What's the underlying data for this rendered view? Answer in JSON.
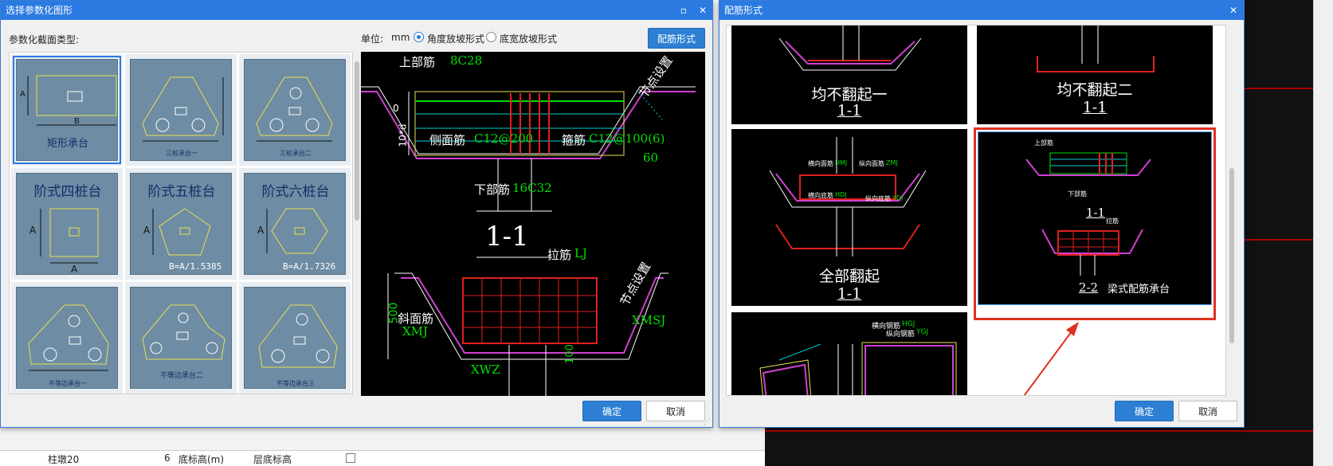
{
  "background": {
    "row_number": "6",
    "row_label": "底标高(m)",
    "row_value": "层底标高",
    "row_partial": "柱墩20"
  },
  "dialog_select": {
    "title": "选择参数化图形",
    "section_type_label": "参数化截面类型:",
    "unit_label": "单位:",
    "unit_value": "mm",
    "radio_angle": "角度放坡形式",
    "radio_width": "底宽放坡形式",
    "rebar_button": "配筋形式",
    "ok_button": "确定",
    "cancel_button": "取消",
    "thumbnails": [
      {
        "label": "矩形承台",
        "dim_a": "A",
        "dim_b": "B"
      },
      {
        "label": "三桩承台一"
      },
      {
        "label": "三桩承台二"
      },
      {
        "label": "阶式四桩台",
        "dim_a": "A",
        "dim_b": "A"
      },
      {
        "label": "阶式五桩台",
        "dim_a": "A",
        "formula": "B=A/1.5385"
      },
      {
        "label": "阶式六桩台",
        "dim_a": "A",
        "formula": "B=A/1.7326"
      },
      {
        "label": "不等边承台一"
      },
      {
        "label": "不等边承台二"
      },
      {
        "label": "不等边承台三"
      }
    ],
    "preview": {
      "top_rebar": "上部筋",
      "top_rebar_val": "8C28",
      "node_setting": "节点设置",
      "side_rebar": "侧面筋",
      "side_rebar_val": "C12@200",
      "stirrup": "箍筋",
      "stirrup_val": "C12@100(6)",
      "angle": "60",
      "dim_zero": "0",
      "dim_10d": "10*d",
      "bottom_rebar": "下部筋",
      "bottom_rebar_val": "16C32",
      "section_11": "1-1",
      "tie_rebar": "拉筋",
      "tie_rebar_val": "LJ",
      "node_setting2": "节点设置",
      "slope_rebar": "斜面筋",
      "slope_code": "XMJ",
      "xmsj": "XMSJ",
      "dim_500": "500",
      "xwz": "XWZ",
      "dim_100": "100"
    }
  },
  "dialog_rebar": {
    "title": "配筋形式",
    "ok_button": "确定",
    "cancel_button": "取消",
    "options": [
      {
        "label": "均不翻起一",
        "section": "1-1"
      },
      {
        "label": "均不翻起二",
        "section": "1-1"
      },
      {
        "label": "全部翻起",
        "section": "1-1"
      },
      {
        "label": "梁式配筋承台",
        "section": "1-1",
        "section2": "2-2"
      }
    ],
    "small_labels": {
      "transverse_top": "横向面筋",
      "tmj": "HMJ",
      "longitudinal_top": "纵向面筋",
      "zmj": "ZMJ",
      "transverse_bottom": "横向底筋",
      "hdj": "HDJ",
      "longitudinal_bottom": "纵向底筋",
      "ydj": "YDJ",
      "transverse_rebar": "横向钢筋",
      "hgj": "HGJ",
      "longitudinal_rebar": "纵向钢筋",
      "ygj": "YGJ",
      "top_rebar_small": "上部筋",
      "bottom_rebar_small": "下部筋",
      "tie_small": "拉筋"
    }
  },
  "colors": {
    "title_blue": "#2a7ae2",
    "primary_button": "#2d7fd3",
    "highlight_red": "#e0301e",
    "cad_black": "#000000"
  }
}
